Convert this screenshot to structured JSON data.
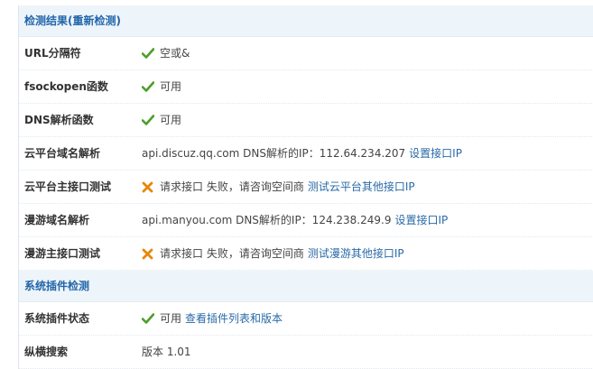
{
  "colors": {
    "ok": "#4a9e2a",
    "fail": "#e8860c",
    "link": "#2a6aa6",
    "header_bg": "#eef5fa"
  },
  "sections": [
    {
      "title": "检测结果(重新检测)",
      "rows": [
        {
          "label": "URL分隔符",
          "status": "ok",
          "icon": "check-icon",
          "text": "空或&",
          "link": ""
        },
        {
          "label": "fsockopen函数",
          "status": "ok",
          "icon": "check-icon",
          "text": "可用",
          "link": ""
        },
        {
          "label": "DNS解析函数",
          "status": "ok",
          "icon": "check-icon",
          "text": "可用",
          "link": ""
        },
        {
          "label": "云平台域名解析",
          "status": "none",
          "icon": "",
          "text": "api.discuz.qq.com DNS解析的IP：112.64.234.207",
          "link": "设置接口IP"
        },
        {
          "label": "云平台主接口测试",
          "status": "fail",
          "icon": "cross-icon",
          "text": "请求接口 失败，请咨询空间商",
          "link": "测试云平台其他接口IP"
        },
        {
          "label": "漫游域名解析",
          "status": "none",
          "icon": "",
          "text": "api.manyou.com DNS解析的IP：124.238.249.9",
          "link": "设置接口IP"
        },
        {
          "label": "漫游主接口测试",
          "status": "fail",
          "icon": "cross-icon",
          "text": "请求接口 失败，请咨询空间商",
          "link": "测试漫游其他接口IP"
        }
      ]
    },
    {
      "title": "系统插件检测",
      "rows": [
        {
          "label": "系统插件状态",
          "status": "ok",
          "icon": "check-icon",
          "text": "可用",
          "link": "查看插件列表和版本"
        },
        {
          "label": "纵横搜索",
          "status": "none",
          "icon": "",
          "text": "版本 1.01",
          "link": ""
        }
      ]
    }
  ]
}
